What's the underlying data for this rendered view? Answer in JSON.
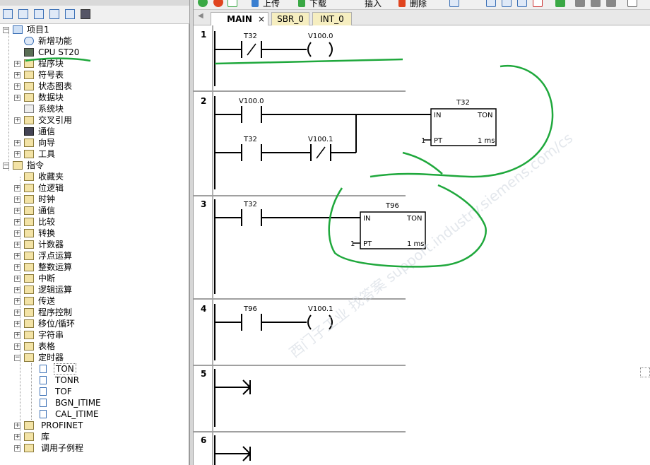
{
  "left_panel": {
    "tree": {
      "project": "项目1",
      "new_features": "新增功能",
      "cpu": "CPU ST20",
      "program_block": "程序块",
      "symbol_table": "符号表",
      "status_chart": "状态图表",
      "data_block": "数据块",
      "system_block": "系统块",
      "cross_ref": "交叉引用",
      "comm": "通信",
      "wizard": "向导",
      "tools": "工具",
      "instructions": "指令",
      "favorites": "收藏夹",
      "bit_logic": "位逻辑",
      "clock": "时钟",
      "communication": "通信",
      "compare": "比较",
      "convert": "转换",
      "counter": "计数器",
      "float_math": "浮点运算",
      "int_math": "整数运算",
      "interrupt": "中断",
      "logic_ops": "逻辑运算",
      "transfer": "传送",
      "program_control": "程序控制",
      "shift_rotate": "移位/循环",
      "string": "字符串",
      "table": "表格",
      "timers": "定时器",
      "ton": "TON",
      "tonr": "TONR",
      "tof": "TOF",
      "bgn_itime": "BGN_ITIME",
      "cal_itime": "CAL_ITIME",
      "profinet": "PROFINET",
      "library": "库",
      "call_subroutine": "调用子例程"
    }
  },
  "toolbar": {
    "upload": "上传",
    "download": "下载",
    "insert": "插入",
    "delete": "删除"
  },
  "tabs": {
    "main": "MAIN",
    "sbr": "SBR_0",
    "int": "INT_0",
    "close": "×"
  },
  "rungs": [
    {
      "num": "1",
      "contact": "T32",
      "contact_type": "NC",
      "coil": "V100.0"
    },
    {
      "num": "2",
      "contact1": "V100.0",
      "contact2": "T32",
      "contact3": "V100.1",
      "timer": "T32",
      "timer_type": "TON",
      "in": "IN",
      "pt": "PT",
      "pt_val": "1",
      "res": "1 ms"
    },
    {
      "num": "3",
      "contact": "T32",
      "timer": "T96",
      "timer_type": "TON",
      "in": "IN",
      "pt": "PT",
      "pt_val": "1",
      "res": "1 ms"
    },
    {
      "num": "4",
      "contact": "T96",
      "coil": "V100.1"
    },
    {
      "num": "5"
    },
    {
      "num": "6"
    }
  ],
  "watermark": "西门子工业  找答案  support.industry.siemens.com/cs",
  "annotation_color": "#1fa83c"
}
